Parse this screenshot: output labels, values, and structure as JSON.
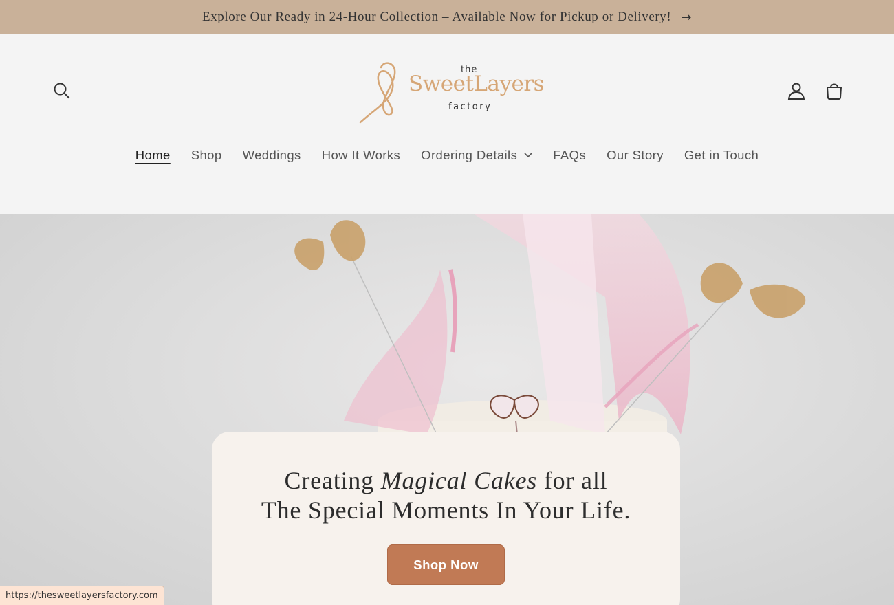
{
  "announcement": {
    "text": "Explore Our Ready in 24-Hour Collection – Available Now for Pickup or Delivery!",
    "arrow": "→"
  },
  "header": {
    "logo": {
      "the": "the",
      "main": "SweetLayers",
      "factory": "factory"
    },
    "icons": {
      "search": "search-icon",
      "account": "user-icon",
      "cart": "cart-icon"
    }
  },
  "nav": {
    "items": [
      {
        "label": "Home",
        "active": true
      },
      {
        "label": "Shop"
      },
      {
        "label": "Weddings"
      },
      {
        "label": "How It Works"
      },
      {
        "label": "Ordering Details",
        "dropdown": true
      },
      {
        "label": "FAQs"
      },
      {
        "label": "Our Story"
      },
      {
        "label": "Get in Touch"
      }
    ],
    "chevron": "⌄"
  },
  "hero": {
    "line1_prefix": "Creating ",
    "line1_em": "Magical Cakes",
    "line1_suffix": " for all",
    "line2": "The Special Moments In Your Life.",
    "cta": "Shop Now"
  },
  "status_bar": {
    "url": "https://thesweetlayersfactory.com"
  },
  "colors": {
    "announcement_bg": "#c9b199",
    "button": "#c17a55",
    "logo_gold": "#d6a676",
    "card_bg": "#f7f2ed"
  }
}
